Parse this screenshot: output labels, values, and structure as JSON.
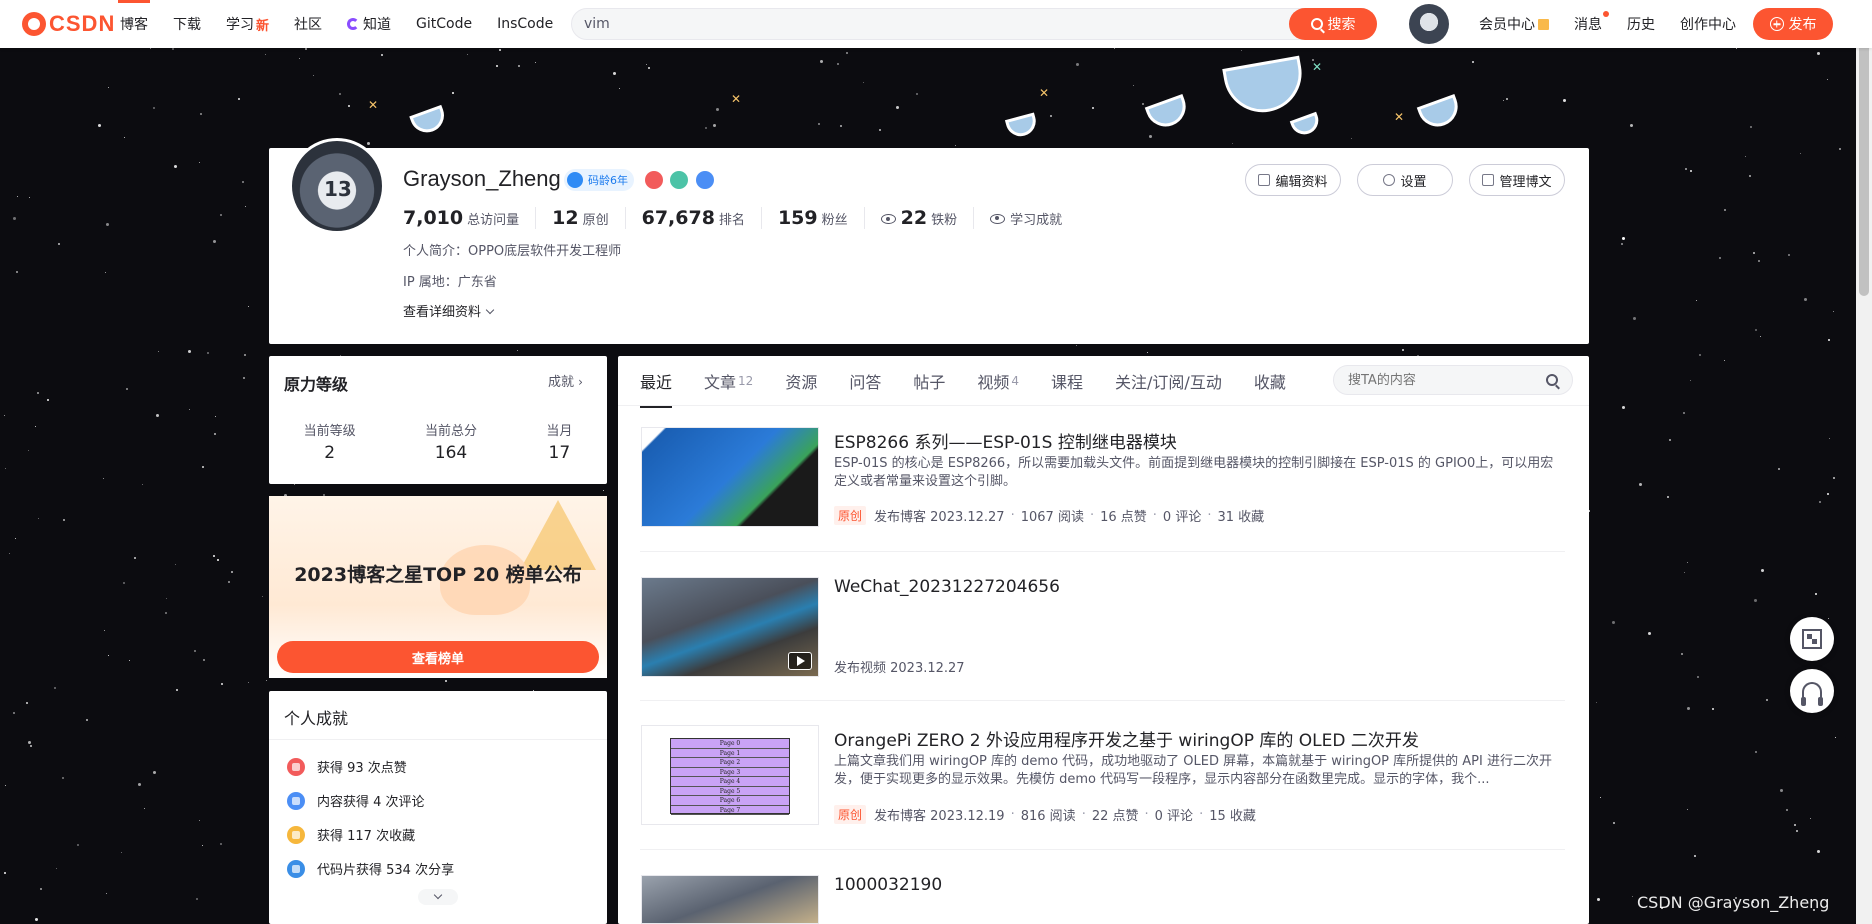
{
  "nav": {
    "logo": "CSDN",
    "links": [
      {
        "label": "博客",
        "active": true
      },
      {
        "label": "下载"
      },
      {
        "label": "学习",
        "new": "新"
      },
      {
        "label": "社区"
      },
      {
        "label": "知道",
        "icon": "knowledge-icon"
      },
      {
        "label": "GitCode"
      },
      {
        "label": "InsCode"
      }
    ],
    "search_value": "vim",
    "search_button": "搜索",
    "right_links": [
      "会员中心",
      "消息",
      "历史",
      "创作中心"
    ],
    "publish": "发布"
  },
  "profile": {
    "username": "Grayson_Zheng",
    "badge": "码龄6年",
    "stats": [
      {
        "num": "7,010",
        "label": "总访问量"
      },
      {
        "num": "12",
        "label": "原创"
      },
      {
        "num": "67,678",
        "label": "排名"
      },
      {
        "num": "159",
        "label": "粉丝"
      },
      {
        "num": "22",
        "label": "铁粉"
      }
    ],
    "learn_achievement": "学习成就",
    "bio": "个人简介：OPPO底层软件开发工程师",
    "ip": "IP 属地：广东省",
    "more": "查看详细资料",
    "buttons": [
      "编辑资料",
      "设置",
      "管理博文"
    ]
  },
  "force": {
    "title": "原力等级",
    "link": "成就",
    "items": [
      {
        "label": "当前等级",
        "value": "2"
      },
      {
        "label": "当前总分",
        "value": "164"
      },
      {
        "label": "当月",
        "value": "17"
      }
    ]
  },
  "promo": {
    "title": "2023博客之星TOP 20 榜单公布",
    "button": "查看榜单"
  },
  "achievements": {
    "title": "个人成就",
    "items": [
      "获得 93 次点赞",
      "内容获得 4 次评论",
      "获得 117 次收藏",
      "代码片获得 534 次分享"
    ]
  },
  "tabs": [
    {
      "label": "最近",
      "active": true
    },
    {
      "label": "文章",
      "count": "12"
    },
    {
      "label": "资源"
    },
    {
      "label": "问答"
    },
    {
      "label": "帖子"
    },
    {
      "label": "视频",
      "count": "4"
    },
    {
      "label": "课程"
    },
    {
      "label": "关注/订阅/互动"
    },
    {
      "label": "收藏"
    }
  ],
  "tab_search_placeholder": "搜TA的内容",
  "articles": [
    {
      "title": "ESP8266 系列——ESP-01S 控制继电器模块",
      "desc": "ESP-01S 的核心是 ESP8266，所以需要加载头文件。前面提到继电器模块的控制引脚接在 ESP-01S 的 GPIO0上，可以用宏定义或者常量来设置这个引脚。",
      "tag": "原创",
      "published": "发布博客 2023.12.27",
      "reads": "1067 阅读",
      "likes": "16 点赞",
      "comments": "0 评论",
      "favs": "31 收藏"
    },
    {
      "title": "WeChat_20231227204656",
      "published": "发布视频 2023.12.27"
    },
    {
      "title": "OrangePi ZERO 2 外设应用程序开发之基于 wiringOP 库的 OLED 二次开发",
      "desc": "上篇文章我们用 wiringOP 库的 demo 代码，成功地驱动了 OLED 屏幕，本篇就基于 wiringOP 库所提供的 API 进行二次开发，便于实现更多的显示效果。先模仿 demo 代码写一段程序，显示内容部分在函数里完成。显示的字体，我个...",
      "tag": "原创",
      "published": "发布博客 2023.12.19",
      "reads": "816 阅读",
      "likes": "22 点赞",
      "comments": "0 评论",
      "favs": "15 收藏"
    },
    {
      "title": "1000032190"
    }
  ],
  "oled_pages": [
    "Page 0",
    "Page 1",
    "Page 2",
    "Page 3",
    "Page 4",
    "Page 5",
    "Page 6",
    "Page 7"
  ],
  "watermark": "CSDN @Grayson_Zheng",
  "colors": {
    "accent": "#fc5531",
    "badge": "#1a7aee"
  }
}
